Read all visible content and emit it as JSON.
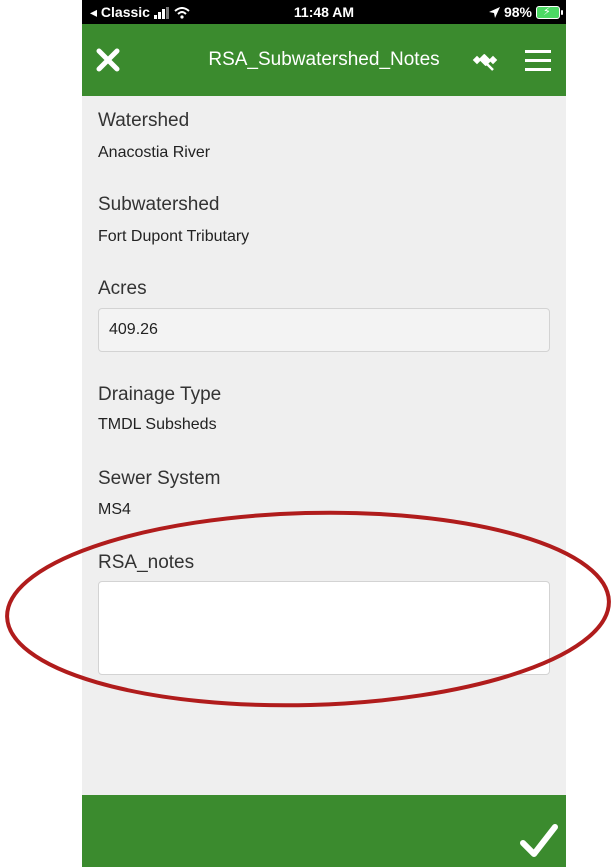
{
  "status_bar": {
    "carrier": "◂ Classic",
    "time": "11:48 AM",
    "battery": "98%"
  },
  "header": {
    "title": "RSA_Subwatershed_Notes",
    "close_icon": "close-icon",
    "satellite_icon": "satellite-icon",
    "menu_icon": "hamburger-menu-icon"
  },
  "fields": {
    "watershed": {
      "label": "Watershed",
      "value": "Anacostia River"
    },
    "subwatershed": {
      "label": "Subwatershed",
      "value": "Fort Dupont Tributary"
    },
    "acres": {
      "label": "Acres",
      "value": "409.26"
    },
    "drainage_type": {
      "label": "Drainage Type",
      "value": "TMDL Subsheds"
    },
    "sewer_system": {
      "label": "Sewer System",
      "value": "MS4"
    },
    "rsa_notes": {
      "label": "RSA_notes",
      "value": ""
    }
  },
  "footer": {
    "submit_icon": "checkmark-icon"
  },
  "colors": {
    "accent": "#3b8b2e",
    "annotation": "#b01c1c",
    "background": "#efefef"
  }
}
